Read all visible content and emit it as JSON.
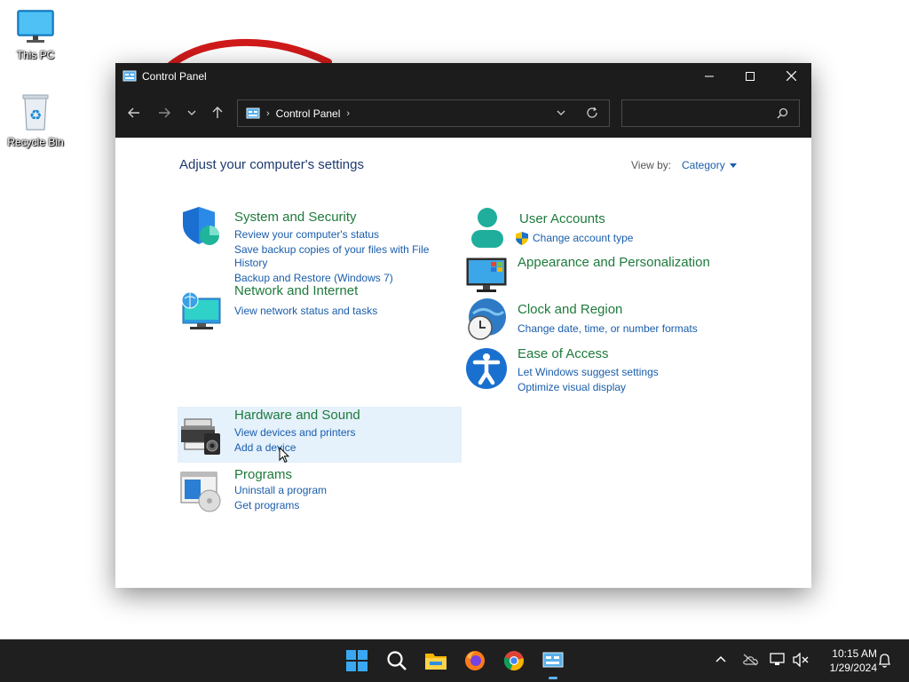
{
  "desktop": {
    "icons": [
      {
        "label": "This PC"
      },
      {
        "label": "Recycle Bin"
      }
    ]
  },
  "window": {
    "title": "Control Panel",
    "breadcrumb": [
      "Control Panel"
    ],
    "search_placeholder": ""
  },
  "content": {
    "heading": "Adjust your computer's settings",
    "view_by_label": "View by:",
    "view_by_value": "Category",
    "left_categories": [
      {
        "title": "System and Security",
        "icon": "shield-icon",
        "links": [
          "Review your computer's status",
          "Save backup copies of your files with File",
          "History",
          "Backup and Restore (Windows 7)"
        ]
      },
      {
        "title": "Network and Internet",
        "icon": "network-icon",
        "links": [
          "View network status and tasks"
        ]
      },
      {
        "title": "Hardware and Sound",
        "icon": "printer-icon",
        "links": [
          "View devices and printers",
          "Add a device"
        ]
      },
      {
        "title": "Programs",
        "icon": "programs-icon",
        "links": [
          "Uninstall a program",
          "Get programs"
        ]
      }
    ],
    "right_categories": [
      {
        "title": "User Accounts",
        "icon": "user-icon",
        "links": [
          "Change account type"
        ]
      },
      {
        "title": "Appearance and Personalization",
        "icon": "monitor-icon",
        "links": []
      },
      {
        "title": "Clock and Region",
        "icon": "clock-globe-icon",
        "links": [
          "Change date, time, or number formats"
        ]
      },
      {
        "title": "Ease of Access",
        "icon": "accessibility-icon",
        "links": [
          "Let Windows suggest settings",
          "Optimize visual display"
        ]
      }
    ]
  },
  "taskbar": {
    "time": "10:15 AM",
    "date": "1/29/2024",
    "apps": [
      "start-icon",
      "search-icon",
      "file-explorer-icon",
      "firefox-icon",
      "chrome-icon",
      "control-panel-icon"
    ]
  },
  "colors": {
    "title_green": "#1e7a3c",
    "link_blue": "#1a5dab",
    "heading_navy": "#1e3a6e",
    "chrome_dark": "#1c1c1c"
  }
}
